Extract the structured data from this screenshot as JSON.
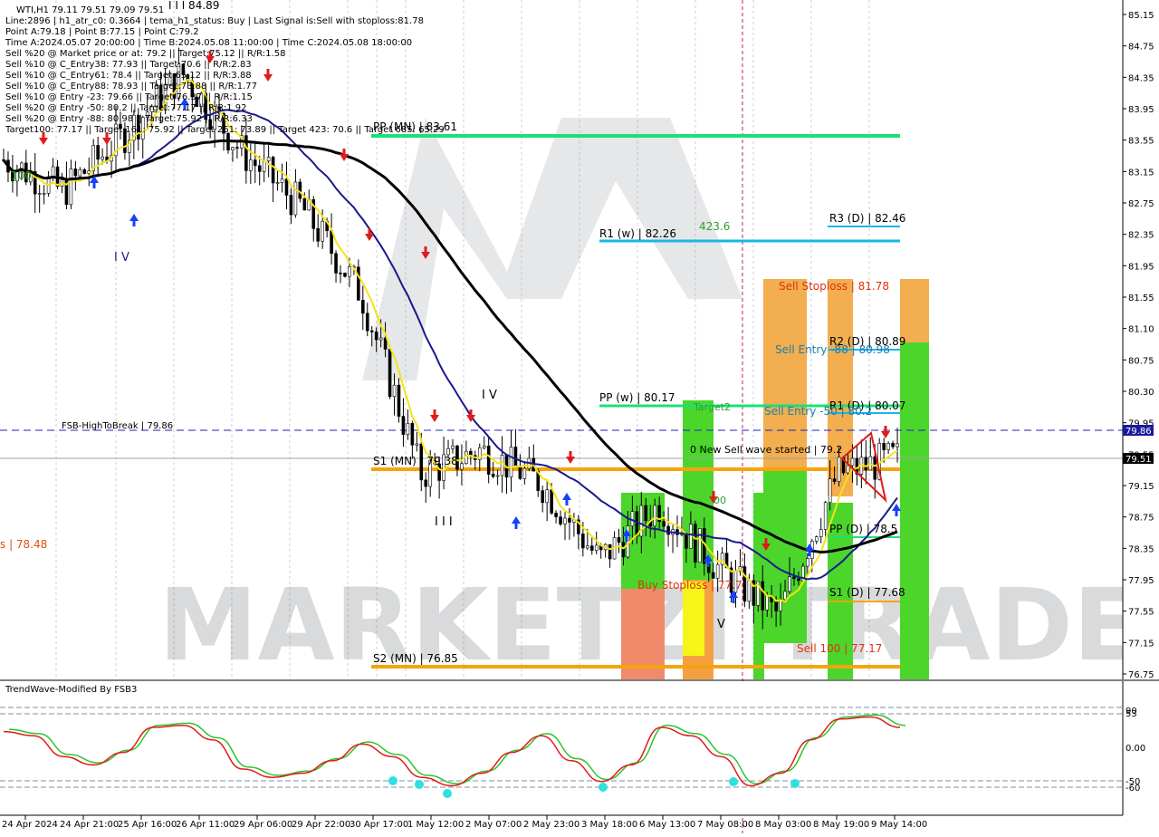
{
  "header": {
    "symbol_line": "WTI,H1  79.11 79.51 79.09 79.51",
    "info_lines": [
      "Line:2896 | h1_atr_c0: 0.3664 | tema_h1_status: Buy | Last Signal is:Sell with stoploss:81.78",
      "Point A:79.18 | Point B:77.15 | Point C:79.2",
      "Time A:2024.05.07 20:00:00 | Time B:2024.05.08 11:00:00 | Time C:2024.05.08 18:00:00",
      "Sell %20 @ Market price or at: 79.2 || Target:75.12 || R/R:1.58",
      "Sell %10 @ C_Entry38: 77.93 || Target:70.6 || R/R:2.83",
      "Sell %10 @ C_Entry61: 78.4 || Target:65.12 || R/R:3.88",
      "Sell %10 @ C_Entry88: 78.93 || Target:73.88 || R/R:1.77",
      "Sell %10 @ Entry -23: 79.66 || Target:76.37 || R/R:1.15",
      "Sell %20 @ Entry -50: 80.2 || Target:77.17 || R/R:1.92",
      "Sell %20 @ Entry -88: 80.98 || Target:75.92 || R/R:6.33",
      "Target100: 77.17 || Target 161: 75.92 || Target 261: 73.89 || Target 423: 70.6 || Target 685: 65.29"
    ]
  },
  "price_axis": {
    "ticks": [
      "85.15",
      "84.75",
      "84.35",
      "83.95",
      "83.55",
      "83.15",
      "82.75",
      "82.35",
      "81.95",
      "81.55",
      "81.10",
      "80.75",
      "80.30",
      "79.95",
      "79.55",
      "79.15",
      "78.75",
      "78.35",
      "77.95",
      "77.55",
      "77.15",
      "76.75"
    ],
    "fsb_marker": "79.86",
    "current_marker": "79.51"
  },
  "time_axis": {
    "ticks": [
      "24 Apr 2024",
      "24 Apr 21:00",
      "25 Apr 16:00",
      "26 Apr 11:00",
      "29 Apr 06:00",
      "29 Apr 22:00",
      "30 Apr 17:00",
      "1 May 12:00",
      "2 May 07:00",
      "2 May 23:00",
      "3 May 18:00",
      "6 May 13:00",
      "7 May 08:00",
      "8 May 03:00",
      "8 May 19:00",
      "9 May 14:00"
    ]
  },
  "levels": {
    "pp_mn": "PP (MN) | 83.61",
    "r1_w": "R1 (w) | 82.26",
    "r3_d": "R3 (D) | 82.46",
    "r2_d": "R2 (D) | 80.89",
    "r1_d": "R1 (D) | 80.07",
    "pp_w": "PP (w) | 80.17",
    "s1_mn": "S1 (MN) | 79.38",
    "pp_d": "PP (D) | 78.5",
    "s1_d": "S1 (D) | 77.68",
    "s2_mn": "S2 (MN) | 76.85",
    "fsb": "FSB-HighToBreak | 79.86",
    "left_price": "s | 78.48"
  },
  "annotations": {
    "sell_stoploss": "Sell Stoploss | 81.78",
    "sell_entry_88": "Sell Entry -88 | 80.98",
    "sell_entry_50": "Sell Entry -50 | 80.2",
    "sell_100": "Sell 100 | 77.17",
    "buy_stoploss": "Buy Stoploss | 77.7",
    "target2": "Target2",
    "new_wave": "0 New Sell wave started | 79.2",
    "fib_423": "423.6",
    "fib_100": "100",
    "wave_iv": "I V",
    "wave_i": "I I I",
    "wave_v": "V",
    "wave_iii": "I I I",
    "top_label": "I I I  84.89",
    "val_00": "00"
  },
  "watermark": {
    "text": "MARKETZI TRADE"
  },
  "oscillator": {
    "title": "TrendWave-Modified By FSB3",
    "ticks": [
      "90",
      "53",
      "0.00",
      "-50",
      "-60"
    ]
  },
  "colors": {
    "pivot_green": "#19e07a",
    "pivot_blue": "#17b7e6",
    "pivot_orange": "#f5a40a",
    "ema_black": "#000000",
    "ema_blue": "#1a1a8c",
    "fast_yellow": "#f3e31a",
    "sell_arrow": "#e01b1b",
    "buy_arrow": "#1440ff",
    "osc_red": "#e01b1b",
    "osc_green": "#2ec42e",
    "osc_dot": "#2ee0e0"
  },
  "chart_data": {
    "type": "candlestick",
    "symbol": "WTI",
    "timeframe": "H1",
    "ylim": [
      76.75,
      85.15
    ],
    "last_close": 79.51,
    "ohlc_last": {
      "open": 79.11,
      "high": 79.51,
      "low": 79.09,
      "close": 79.51
    },
    "close_trace": [
      {
        "t": "24 Apr 2024",
        "y": 83.3
      },
      {
        "t": "24 Apr 21:00",
        "y": 82.9
      },
      {
        "t": "25 Apr 16:00",
        "y": 83.6
      },
      {
        "t": "26 Apr 11:00",
        "y": 84.4
      },
      {
        "t": "29 Apr 06:00",
        "y": 83.4
      },
      {
        "t": "29 Apr 22:00",
        "y": 82.7
      },
      {
        "t": "30 Apr 17:00",
        "y": 81.6
      },
      {
        "t": "1 May 12:00",
        "y": 79.3
      },
      {
        "t": "2 May 07:00",
        "y": 79.6
      },
      {
        "t": "2 May 23:00",
        "y": 79.2
      },
      {
        "t": "3 May 18:00",
        "y": 78.2
      },
      {
        "t": "6 May 13:00",
        "y": 78.9
      },
      {
        "t": "7 May 08:00",
        "y": 78.1
      },
      {
        "t": "8 May 03:00",
        "y": 77.5
      },
      {
        "t": "8 May 19:00",
        "y": 79.3
      },
      {
        "t": "9 May 14:00",
        "y": 79.51
      }
    ],
    "pivot_levels": [
      {
        "name": "PP (MN)",
        "value": 83.61
      },
      {
        "name": "R3 (D)",
        "value": 82.46
      },
      {
        "name": "R1 (w)",
        "value": 82.26
      },
      {
        "name": "R2 (D)",
        "value": 80.89
      },
      {
        "name": "PP (w)",
        "value": 80.17
      },
      {
        "name": "R1 (D)",
        "value": 80.07
      },
      {
        "name": "S1 (MN)",
        "value": 79.38
      },
      {
        "name": "PP (D)",
        "value": 78.5
      },
      {
        "name": "S1 (D)",
        "value": 77.68
      },
      {
        "name": "S2 (MN)",
        "value": 76.85
      }
    ],
    "fsb_high_to_break": 79.86,
    "sell_stoploss": 81.78,
    "sell_entries": [
      80.98,
      80.2
    ],
    "sell_target_100": 77.17,
    "buy_stoploss": 77.7
  }
}
